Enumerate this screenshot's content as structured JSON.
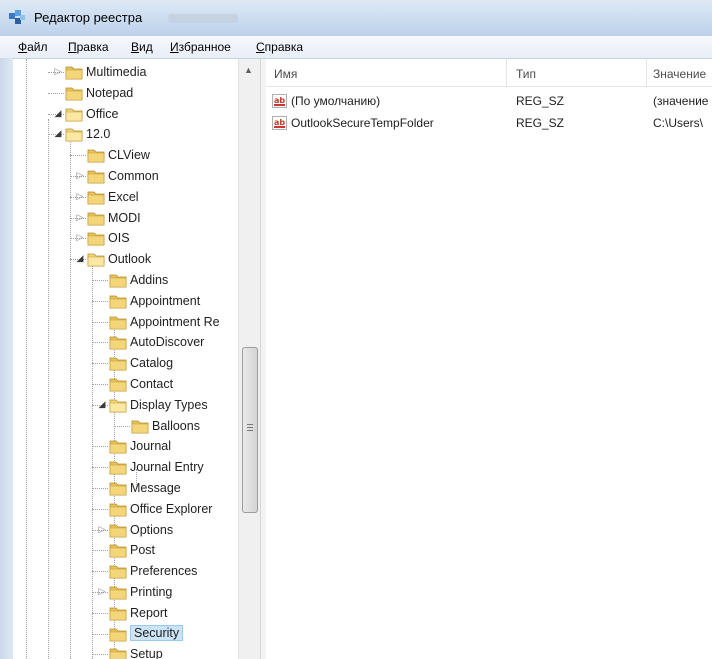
{
  "window": {
    "title": "Редактор реестра"
  },
  "menu": [
    "Файл",
    "Правка",
    "Вид",
    "Избранное",
    "Справка"
  ],
  "tree": {
    "items": [
      {
        "label": "Multimedia",
        "arrow": "▷"
      },
      {
        "label": "Notepad",
        "arrow": ""
      },
      {
        "label": "Office",
        "arrow": "◢"
      },
      {
        "label": "12.0",
        "arrow": "◢"
      },
      {
        "label": "CLView",
        "arrow": ""
      },
      {
        "label": "Common",
        "arrow": "▷"
      },
      {
        "label": "Excel",
        "arrow": "▷"
      },
      {
        "label": "MODI",
        "arrow": "▷"
      },
      {
        "label": "OIS",
        "arrow": "▷"
      },
      {
        "label": "Outlook",
        "arrow": "◢"
      },
      {
        "label": "Addins",
        "arrow": ""
      },
      {
        "label": "Appointment",
        "arrow": ""
      },
      {
        "label": "Appointment Re",
        "arrow": ""
      },
      {
        "label": "AutoDiscover",
        "arrow": ""
      },
      {
        "label": "Catalog",
        "arrow": ""
      },
      {
        "label": "Contact",
        "arrow": ""
      },
      {
        "label": "Display Types",
        "arrow": "◢"
      },
      {
        "label": "Balloons",
        "arrow": ""
      },
      {
        "label": "Journal",
        "arrow": ""
      },
      {
        "label": "Journal Entry",
        "arrow": ""
      },
      {
        "label": "Message",
        "arrow": ""
      },
      {
        "label": "Office Explorer",
        "arrow": ""
      },
      {
        "label": "Options",
        "arrow": "▷"
      },
      {
        "label": "Post",
        "arrow": ""
      },
      {
        "label": "Preferences",
        "arrow": ""
      },
      {
        "label": "Printing",
        "arrow": "▷"
      },
      {
        "label": "Report",
        "arrow": ""
      },
      {
        "label": "Security",
        "arrow": ""
      },
      {
        "label": "Setup",
        "arrow": ""
      }
    ],
    "scroll_up_glyph": "▲"
  },
  "list": {
    "columns": [
      "Имя",
      "Тип",
      "Значение"
    ],
    "rows": [
      {
        "name": "(По умолчанию)",
        "type": "REG_SZ",
        "value": "(значение"
      },
      {
        "name": "OutlookSecureTempFolder",
        "type": "REG_SZ",
        "value": "C:\\Users\\"
      }
    ]
  },
  "colors": {
    "selection": "#cce4f7",
    "folder": "#e8c15a",
    "titlebar": "#c9dbef"
  }
}
